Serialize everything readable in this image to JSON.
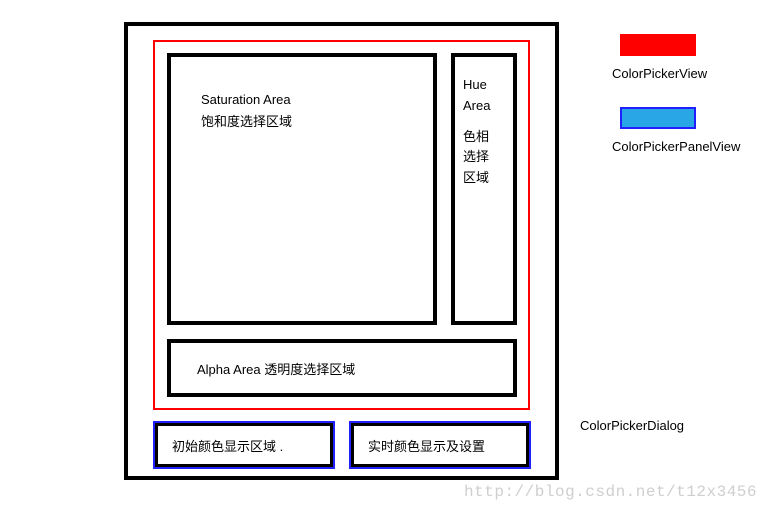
{
  "saturation": {
    "title_en": "Saturation  Area",
    "title_zh": "饱和度选择区域"
  },
  "hue": {
    "title_en": "Hue Area",
    "line1": "色相",
    "line2": "选择",
    "line3": "区域"
  },
  "alpha": {
    "label": "Alpha Area 透明度选择区域"
  },
  "panels": {
    "initial": "初始颜色显示区域  .",
    "realtime": "实时颜色显示及设置"
  },
  "legend": {
    "red_label": "ColorPickerView",
    "blue_label": "ColorPickerPanelView",
    "dialog_label": "ColorPickerDialog"
  },
  "watermark": "http://blog.csdn.net/t12x3456"
}
